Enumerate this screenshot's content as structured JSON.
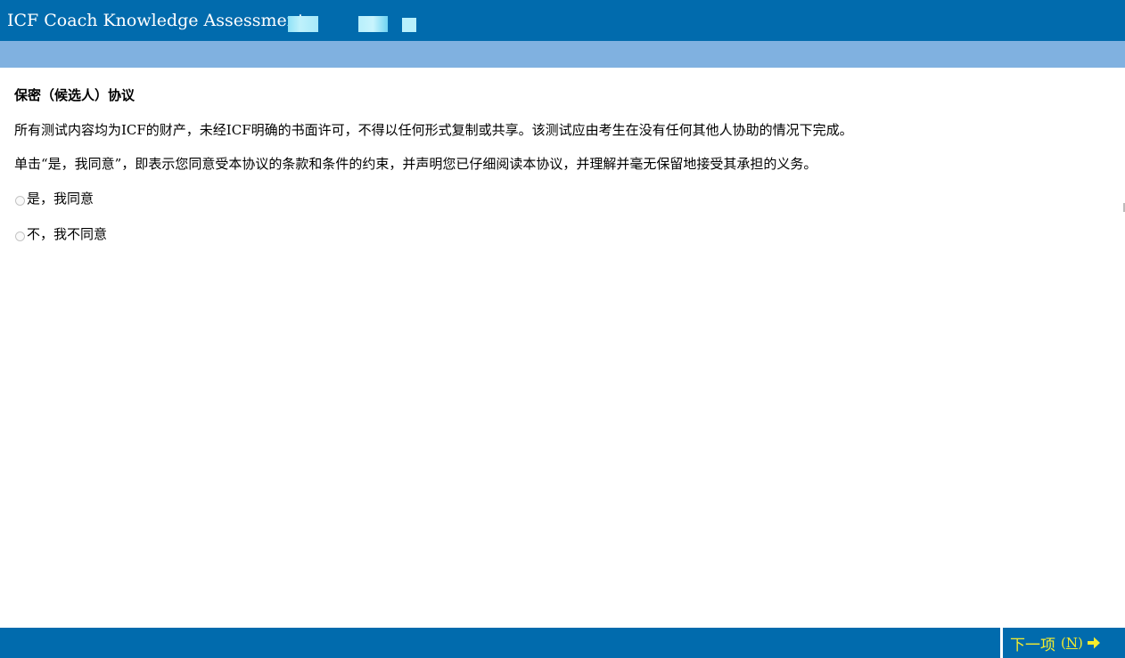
{
  "header": {
    "title": "ICF Coach Knowledge Assessment -"
  },
  "main": {
    "heading": "保密（候选人）协议",
    "paragraphs": [
      "所有测试内容均为ICF的财产，未经ICF明确的书面许可，不得以任何形式复制或共享。该测试应由考生在没有任何其他人协助的情况下完成。",
      "单击“是，我同意”，即表示您同意受本协议的条款和条件的约束，并声明您已仔细阅读本协议，并理解并毫无保留地接受其承担的义务。"
    ],
    "options": [
      {
        "label": "是，我同意",
        "selected": false
      },
      {
        "label": "不，我不同意",
        "selected": false
      }
    ]
  },
  "footer": {
    "next_label": "下一项",
    "next_key_open": "(",
    "next_key_letter": "N",
    "next_key_close": ")",
    "next_icon": "arrow-right-icon"
  },
  "colors": {
    "header_bg": "#016bad",
    "subbar_bg": "#80b1e0",
    "next_text": "#f5ec2e"
  }
}
